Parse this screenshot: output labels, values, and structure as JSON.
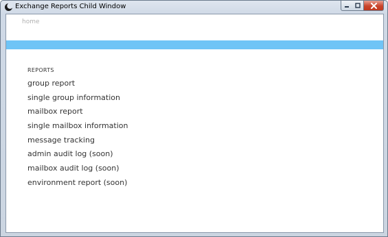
{
  "window": {
    "title": "Exchange Reports Child Window",
    "icon": "moon-icon"
  },
  "breadcrumb": "home",
  "accent_color": "#6fc4f6",
  "reports": {
    "heading": "REPORTS",
    "items": [
      "group report",
      "single group information",
      "mailbox report",
      "single mailbox information",
      "message tracking",
      "admin audit log (soon)",
      "mailbox audit log (soon)",
      "environment report (soon)"
    ]
  }
}
